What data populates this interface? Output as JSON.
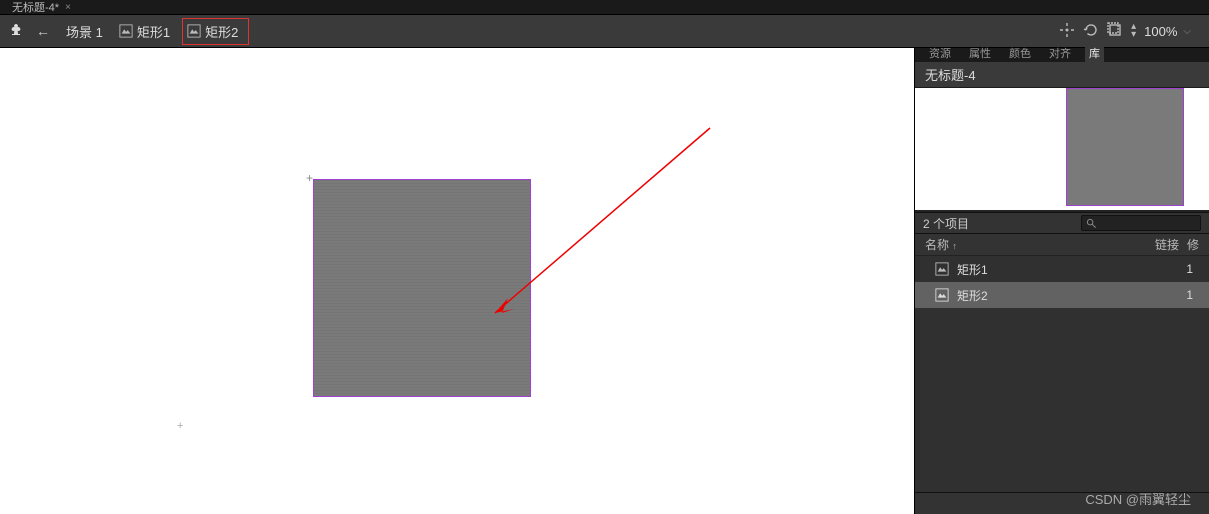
{
  "document": {
    "title": "无标题-4*"
  },
  "toolbar": {
    "breadcrumb": {
      "scene": "场景 1",
      "shape1": "矩形1",
      "shape2": "矩形2"
    },
    "zoom": "100%"
  },
  "panel": {
    "tabs": {
      "resources": "资源",
      "properties": "属性",
      "color": "颜色",
      "align": "对齐",
      "library": "库"
    },
    "header": "无标题-4",
    "library": {
      "count_label": "2 个项目",
      "columns": {
        "name": "名称",
        "link": "链接",
        "last": "修"
      },
      "items": [
        {
          "name": "矩形1",
          "use": "1"
        },
        {
          "name": "矩形2",
          "use": "1"
        }
      ]
    }
  },
  "watermark": "CSDN @雨翼轻尘"
}
